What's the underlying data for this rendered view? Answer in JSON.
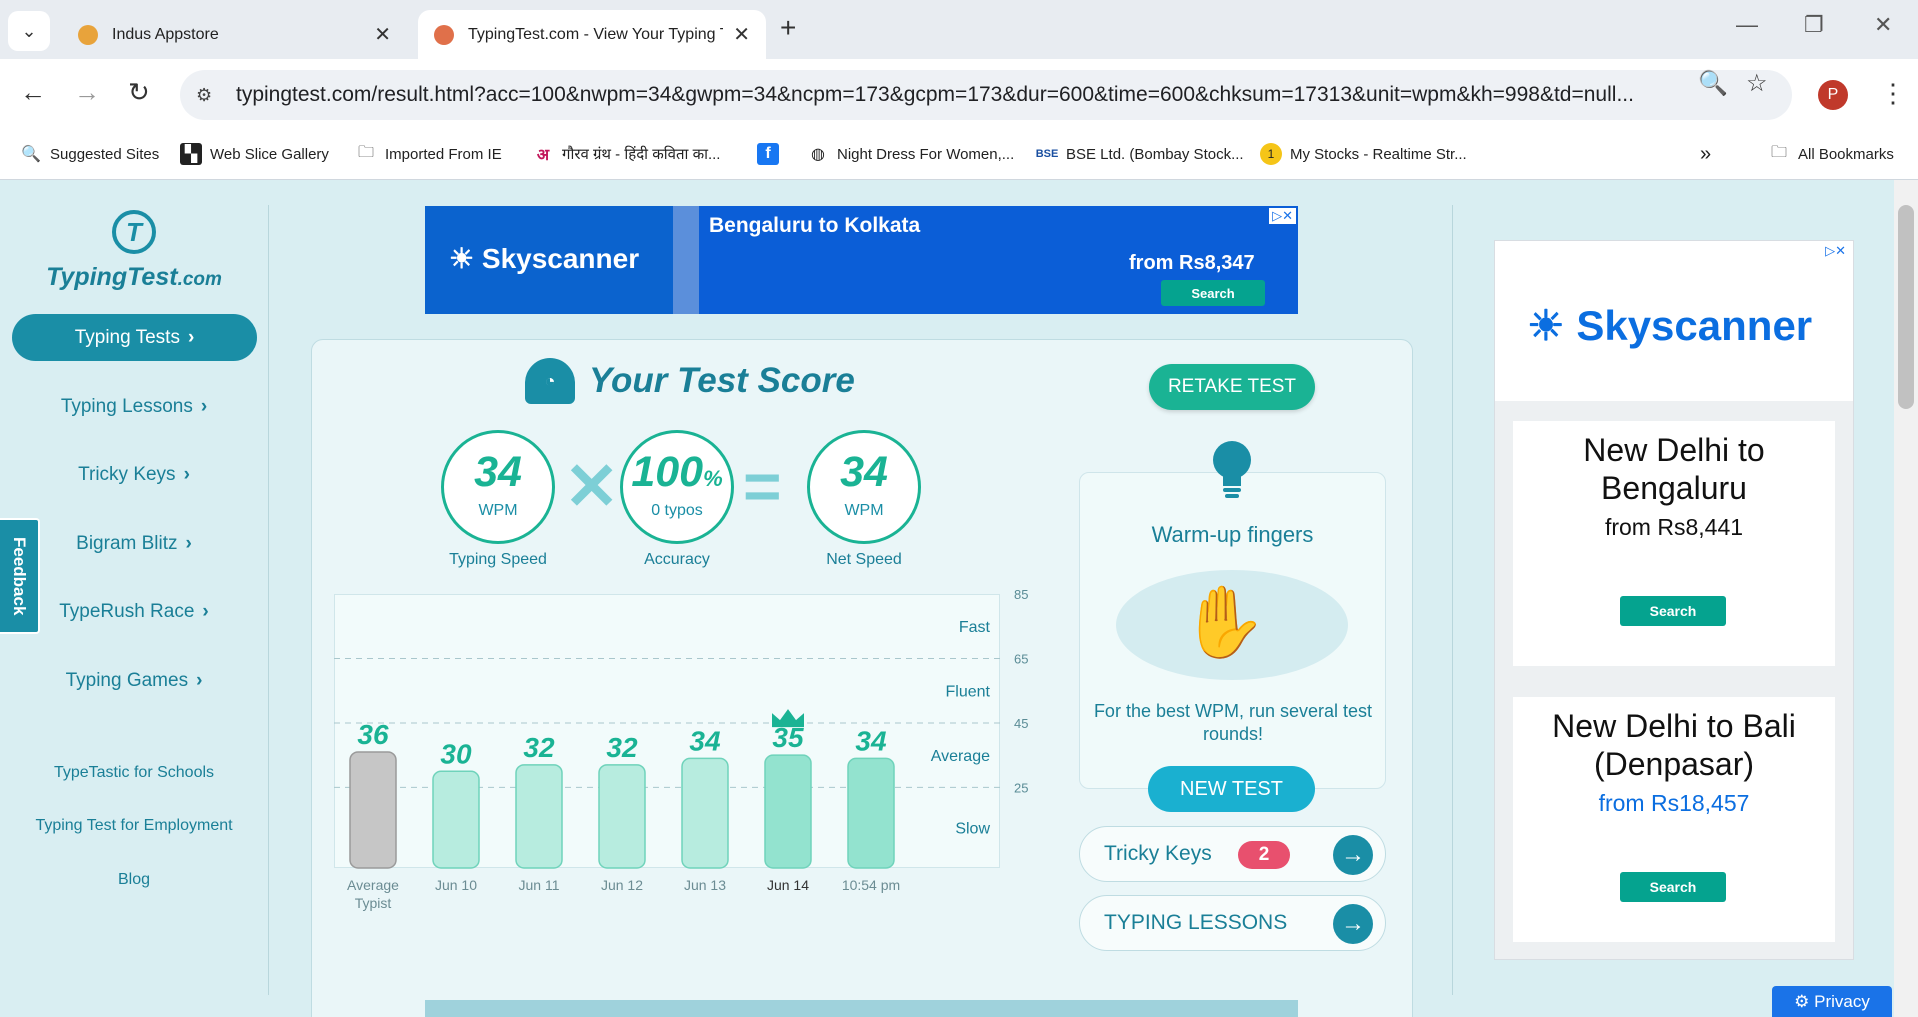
{
  "browser": {
    "tabs": [
      {
        "title": "Indus Appstore",
        "favicon_color": "#e8a33b"
      },
      {
        "title": "TypingTest.com - View Your Typing Te",
        "favicon_color": "#e0704a"
      }
    ],
    "url": "typingtest.com/result.html?acc=100&nwpm=34&gwpm=34&ncpm=173&gcpm=173&dur=600&time=600&chksum=17313&unit=wpm&kh=998&td=null...",
    "profile_initial": "P",
    "bookmarks": [
      "Suggested Sites",
      "Web Slice Gallery",
      "Imported From IE",
      "गौरव ग्रंथ - हिंदी कविता का...",
      "",
      "Night Dress For Women,...",
      "BSE Ltd. (Bombay Stock...",
      "My Stocks - Realtime Str...",
      "All Bookmarks"
    ]
  },
  "sidebar": {
    "logo": {
      "name": "TypingTest",
      "suffix": ".com"
    },
    "nav": [
      "Typing Tests",
      "Typing Lessons",
      "Tricky Keys",
      "Bigram Blitz",
      "TypeRush Race",
      "Typing Games"
    ],
    "links": [
      "TypeTastic for Schools",
      "Typing Test for Employment",
      "Blog"
    ],
    "feedback": "Feedback"
  },
  "ad_top": {
    "brand": "Skyscanner",
    "route": "Bengaluru to Kolkata",
    "price": "from Rs8,347",
    "button": "Search"
  },
  "score": {
    "title": "Your Test Score",
    "speed": {
      "value": "34",
      "unit": "WPM",
      "label": "Typing Speed"
    },
    "accuracy": {
      "value": "100",
      "pct": "%",
      "sub": "0 typos",
      "label": "Accuracy"
    },
    "net": {
      "value": "34",
      "unit": "WPM",
      "label": "Net Speed"
    },
    "retake": "RETAKE TEST"
  },
  "chart_data": {
    "type": "bar",
    "categories": [
      "Average Typist",
      "Jun 10",
      "Jun 11",
      "Jun 12",
      "Jun 13",
      "Jun 14",
      "10:54 pm"
    ],
    "values": [
      36,
      30,
      32,
      32,
      34,
      35,
      34
    ],
    "ylim": [
      0,
      85
    ],
    "yticks": [
      25,
      45,
      65,
      85
    ],
    "bands": [
      "Slow",
      "Average",
      "Fluent",
      "Fast"
    ],
    "highlight_index": 5,
    "colors": {
      "average": "#c6c6c6",
      "bar": "#b7ecdf",
      "best": "#93e3cf",
      "label": "#1ab394"
    }
  },
  "warmup": {
    "title": "Warm-up fingers",
    "text": "For the best WPM, run several test rounds!",
    "button": "NEW TEST"
  },
  "links_panel": {
    "tricky_keys": {
      "label": "Tricky Keys",
      "count": "2"
    },
    "lessons": {
      "label": "TYPING LESSONS"
    }
  },
  "ad_right": {
    "brand": "Skyscanner",
    "offers": [
      {
        "dest": "New Delhi to Bengaluru",
        "price": "from Rs8,441",
        "button": "Search"
      },
      {
        "dest": "New Delhi to Bali (Denpasar)",
        "price": "from Rs18,457",
        "button": "Search"
      }
    ]
  },
  "privacy": "Privacy"
}
